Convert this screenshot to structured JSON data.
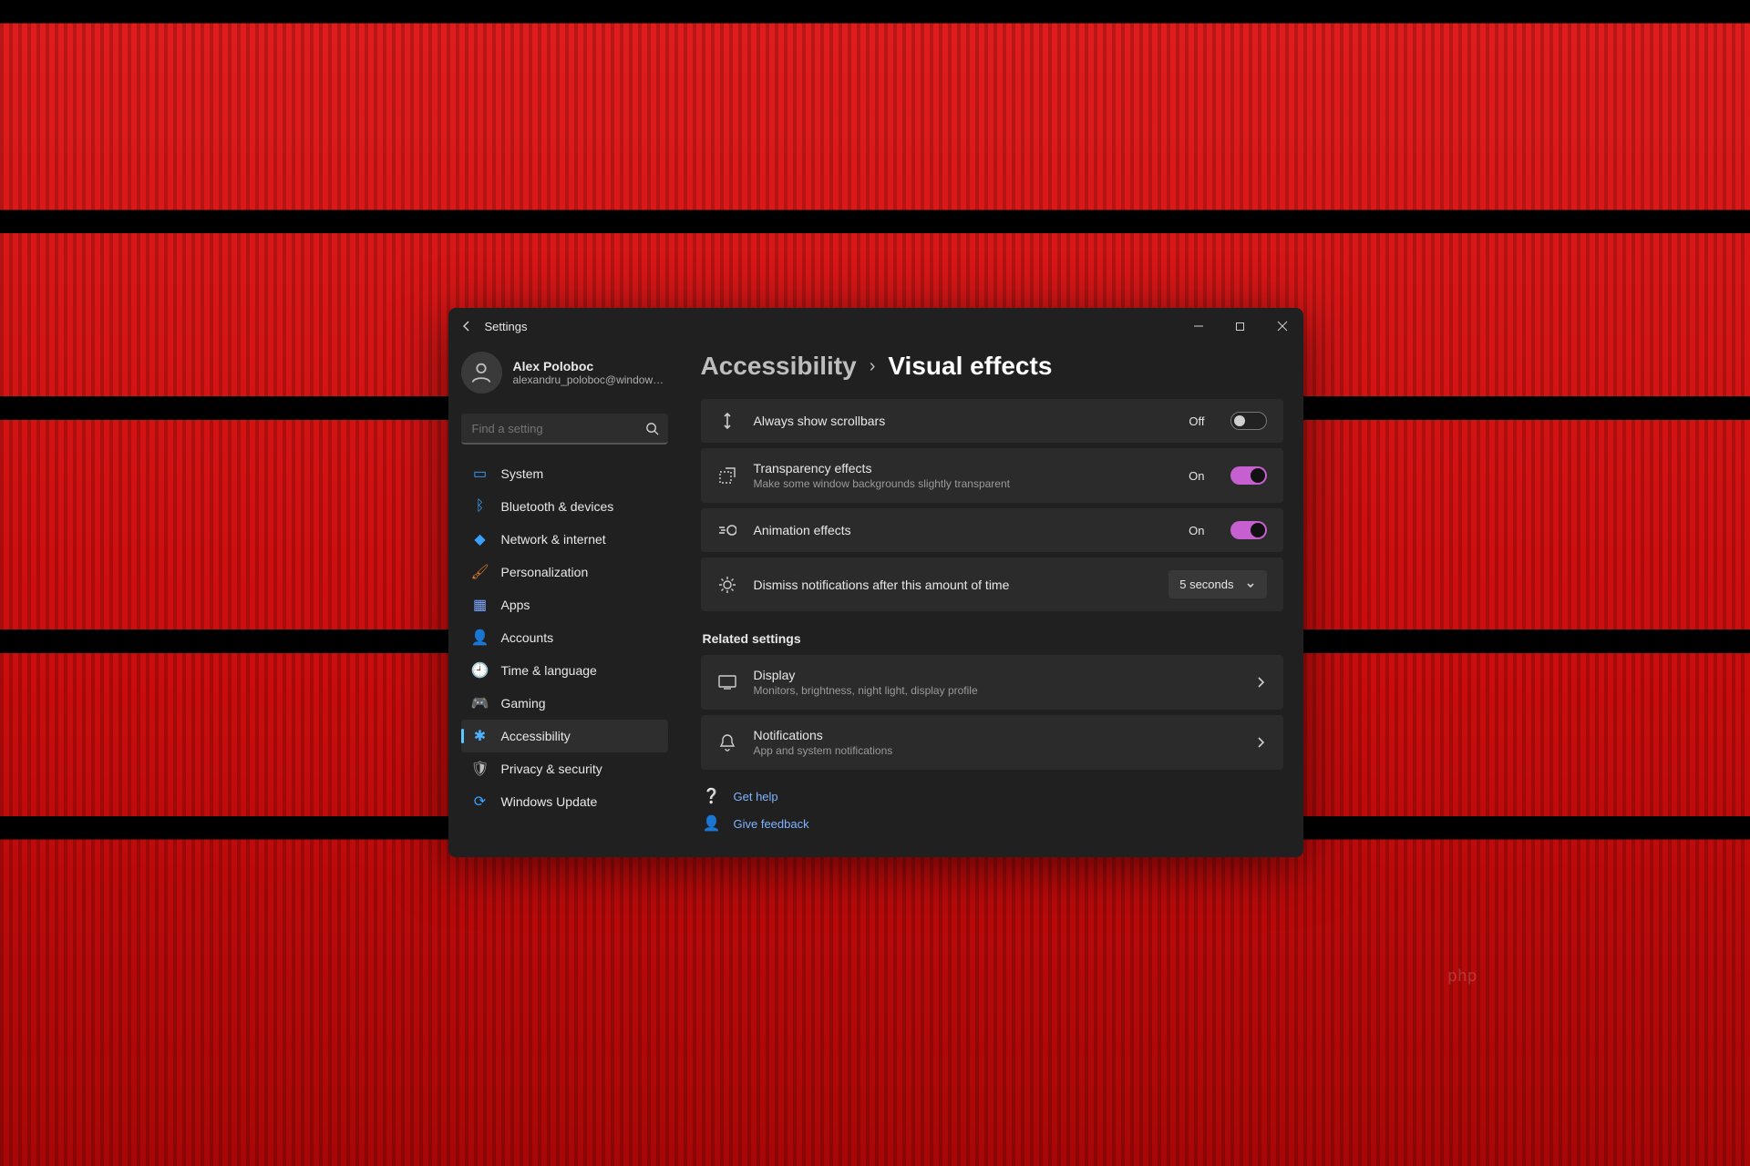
{
  "window": {
    "title": "Settings"
  },
  "user": {
    "name": "Alex Poloboc",
    "email": "alexandru_poloboc@windowsreport…"
  },
  "search": {
    "placeholder": "Find a setting"
  },
  "sidebar": {
    "items": [
      {
        "label": "System"
      },
      {
        "label": "Bluetooth & devices"
      },
      {
        "label": "Network & internet"
      },
      {
        "label": "Personalization"
      },
      {
        "label": "Apps"
      },
      {
        "label": "Accounts"
      },
      {
        "label": "Time & language"
      },
      {
        "label": "Gaming"
      },
      {
        "label": "Accessibility"
      },
      {
        "label": "Privacy & security"
      },
      {
        "label": "Windows Update"
      }
    ]
  },
  "breadcrumb": {
    "parent": "Accessibility",
    "leaf": "Visual effects"
  },
  "settings": {
    "scrollbars": {
      "title": "Always show scrollbars",
      "state": "Off"
    },
    "transparency": {
      "title": "Transparency effects",
      "subtitle": "Make some window backgrounds slightly transparent",
      "state": "On"
    },
    "animation": {
      "title": "Animation effects",
      "state": "On"
    },
    "dismiss": {
      "title": "Dismiss notifications after this amount of time",
      "value": "5 seconds"
    }
  },
  "related": {
    "label": "Related settings",
    "display": {
      "title": "Display",
      "subtitle": "Monitors, brightness, night light, display profile"
    },
    "notifications": {
      "title": "Notifications",
      "subtitle": "App and system notifications"
    }
  },
  "footer": {
    "help": "Get help",
    "feedback": "Give feedback"
  },
  "watermark": "php"
}
